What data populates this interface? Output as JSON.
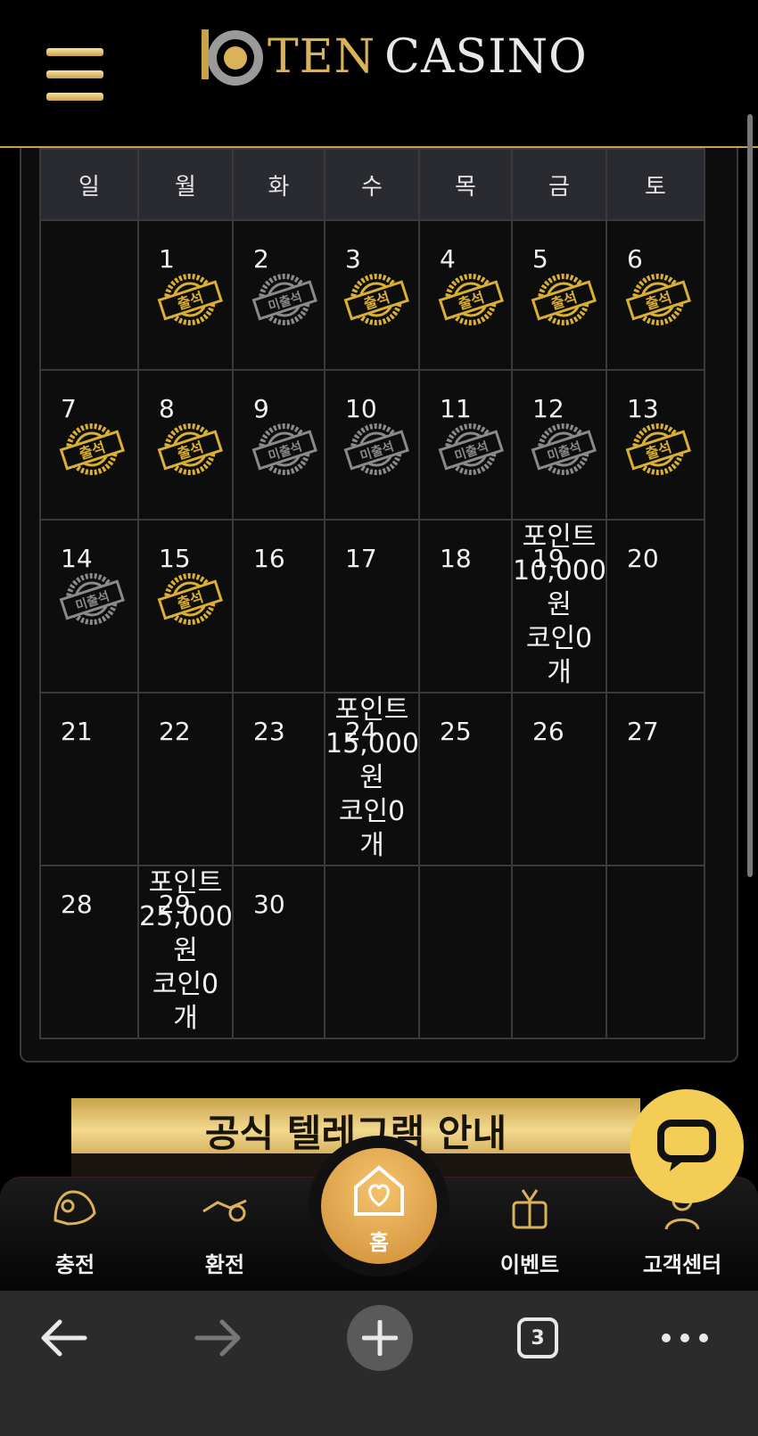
{
  "header": {
    "logo_ten": "TEN",
    "logo_casino": "CASINO"
  },
  "calendar": {
    "weekdays": [
      "일",
      "월",
      "화",
      "수",
      "목",
      "금",
      "토"
    ],
    "stamp_labels": {
      "attended": "출석",
      "absent": "미출석"
    },
    "weeks": [
      [
        {
          "day": "",
          "status": ""
        },
        {
          "day": "1",
          "status": "attended"
        },
        {
          "day": "2",
          "status": "absent"
        },
        {
          "day": "3",
          "status": "attended"
        },
        {
          "day": "4",
          "status": "attended"
        },
        {
          "day": "5",
          "status": "attended"
        },
        {
          "day": "6",
          "status": "attended"
        }
      ],
      [
        {
          "day": "7",
          "status": "attended"
        },
        {
          "day": "8",
          "status": "attended"
        },
        {
          "day": "9",
          "status": "absent"
        },
        {
          "day": "10",
          "status": "absent"
        },
        {
          "day": "11",
          "status": "absent"
        },
        {
          "day": "12",
          "status": "absent"
        },
        {
          "day": "13",
          "status": "attended"
        }
      ],
      [
        {
          "day": "14",
          "status": "absent"
        },
        {
          "day": "15",
          "status": "attended"
        },
        {
          "day": "16",
          "status": ""
        },
        {
          "day": "17",
          "status": ""
        },
        {
          "day": "18",
          "status": ""
        },
        {
          "day": "19",
          "status": "",
          "reward": [
            "포인트",
            "10,000",
            "원",
            "코인0",
            "개"
          ]
        },
        {
          "day": "20",
          "status": ""
        }
      ],
      [
        {
          "day": "21",
          "status": ""
        },
        {
          "day": "22",
          "status": ""
        },
        {
          "day": "23",
          "status": ""
        },
        {
          "day": "24",
          "status": "",
          "reward": [
            "포인트",
            "15,000",
            "원",
            "코인0",
            "개"
          ]
        },
        {
          "day": "25",
          "status": ""
        },
        {
          "day": "26",
          "status": ""
        },
        {
          "day": "27",
          "status": ""
        }
      ],
      [
        {
          "day": "28",
          "status": ""
        },
        {
          "day": "29",
          "status": "",
          "reward": [
            "포인트",
            "25,000",
            "원",
            "코인0",
            "개"
          ]
        },
        {
          "day": "30",
          "status": ""
        },
        {
          "day": "",
          "status": ""
        },
        {
          "day": "",
          "status": ""
        },
        {
          "day": "",
          "status": ""
        },
        {
          "day": "",
          "status": ""
        }
      ]
    ]
  },
  "banner": {
    "text": "공식 텔레그램 안내"
  },
  "bottom_nav": {
    "items": [
      {
        "label": "충전",
        "icon": "deposit-icon"
      },
      {
        "label": "환전",
        "icon": "exchange-icon"
      },
      {
        "label": "홈",
        "icon": "home-heart-icon"
      },
      {
        "label": "이벤트",
        "icon": "gift-icon"
      },
      {
        "label": "고객센터",
        "icon": "support-icon"
      }
    ]
  },
  "browser": {
    "tab_count": "3"
  },
  "colors": {
    "gold": "#c9a24a",
    "sunday": "#e43b3b",
    "saturday": "#6fb7f0",
    "chat_button": "#f3cd55"
  }
}
